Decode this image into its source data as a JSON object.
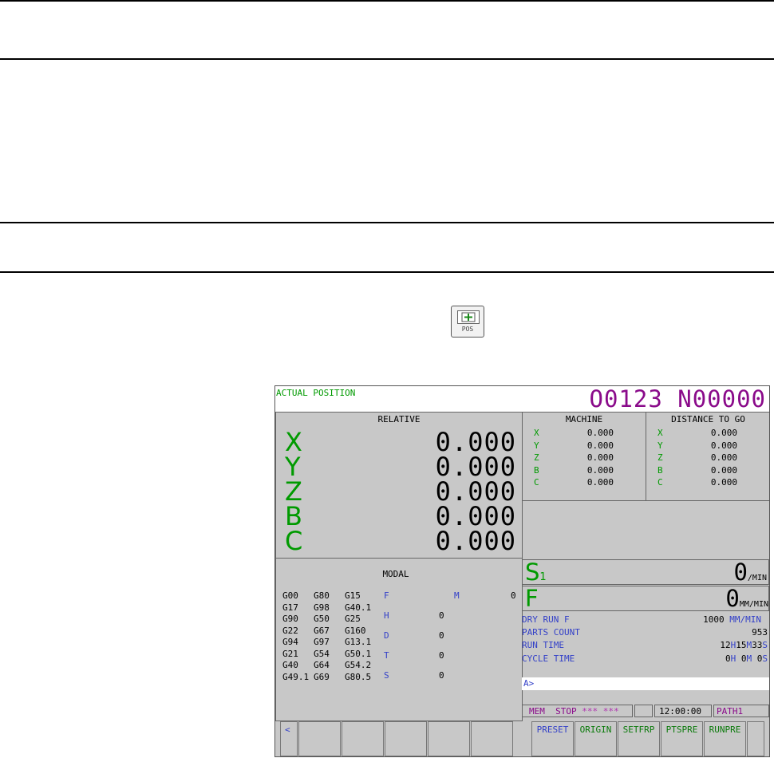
{
  "key": {
    "label": "POS"
  },
  "screen": {
    "header": {
      "title": "ACTUAL POSITION",
      "program": "O0123 N00000"
    },
    "relative": {
      "title": "RELATIVE",
      "axes": [
        {
          "name": "X",
          "value": "0.000"
        },
        {
          "name": "Y",
          "value": "0.000"
        },
        {
          "name": "Z",
          "value": "0.000"
        },
        {
          "name": "B",
          "value": "0.000"
        },
        {
          "name": "C",
          "value": "0.000"
        }
      ]
    },
    "machine": {
      "title": "MACHINE",
      "axes": [
        {
          "name": "X",
          "value": "0.000"
        },
        {
          "name": "Y",
          "value": "0.000"
        },
        {
          "name": "Z",
          "value": "0.000"
        },
        {
          "name": "B",
          "value": "0.000"
        },
        {
          "name": "C",
          "value": "0.000"
        }
      ]
    },
    "distance": {
      "title": "DISTANCE TO GO",
      "axes": [
        {
          "name": "X",
          "value": "0.000"
        },
        {
          "name": "Y",
          "value": "0.000"
        },
        {
          "name": "Z",
          "value": "0.000"
        },
        {
          "name": "B",
          "value": "0.000"
        },
        {
          "name": "C",
          "value": "0.000"
        }
      ]
    },
    "modal": {
      "title": "MODAL",
      "rows": [
        [
          "G00",
          "G80",
          "G15"
        ],
        [
          "G17",
          "G98",
          "G40.1"
        ],
        [
          "G90",
          "G50",
          "G25"
        ],
        [
          "G22",
          "G67",
          "G160"
        ],
        [
          "G94",
          "G97",
          "G13.1"
        ],
        [
          "G21",
          "G54",
          "G50.1"
        ],
        [
          "G40",
          "G64",
          "G54.2"
        ],
        [
          "G49.1",
          "G69",
          "G80.5"
        ]
      ],
      "codes": [
        {
          "label": "F",
          "value": ""
        },
        {
          "label": "H",
          "value": "0"
        },
        {
          "label": "D",
          "value": "0"
        },
        {
          "label": "T",
          "value": "0"
        },
        {
          "label": "S",
          "value": "0"
        }
      ],
      "m_label": "M",
      "m_value": "0"
    },
    "spindle": {
      "label": "S",
      "sub": "1",
      "value": "0",
      "unit": "/MIN"
    },
    "feed": {
      "label": "F",
      "value": "0",
      "unit": "MM/MIN"
    },
    "info": {
      "dry_run_label": "DRY RUN F",
      "dry_run_value": "1000",
      "dry_run_unit": "MM/MIN",
      "parts_label": "PARTS COUNT",
      "parts_value": "953",
      "run_label": "RUN TIME",
      "run": {
        "h": "12",
        "hl": "H",
        "m": "15",
        "ml": "M",
        "s": "33",
        "sl": "S"
      },
      "cycle_label": "CYCLE TIME",
      "cycle": {
        "h": "0",
        "hl": "H",
        "m": " 0",
        "ml": "M",
        "s": " 0",
        "sl": "S"
      }
    },
    "input_prompt": "A>",
    "status": {
      "mode": "MEM",
      "state": "STOP",
      "alarm": "*** ***",
      "time": "12:00:00",
      "path": "PATH1"
    },
    "softkeys": {
      "back": "<",
      "labels": [
        "PRESET",
        "ORIGIN",
        "SETFRP",
        "PTSPRE",
        "RUNPRE"
      ]
    }
  }
}
